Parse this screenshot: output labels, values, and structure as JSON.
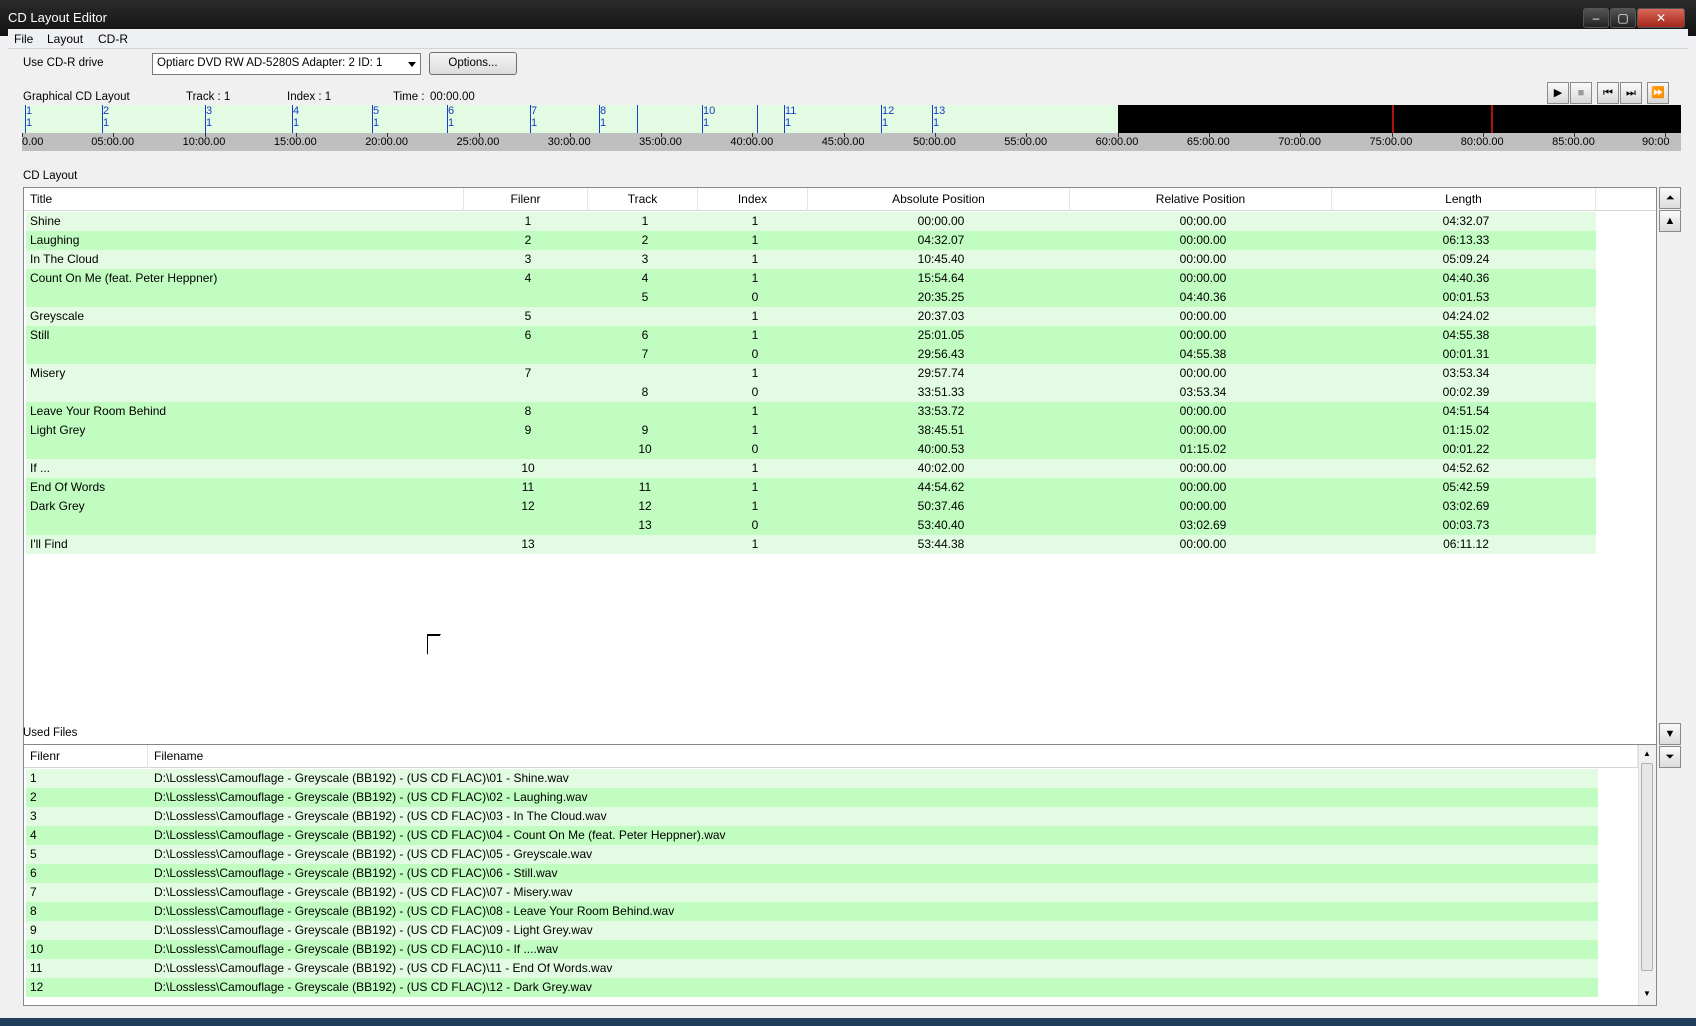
{
  "window": {
    "title": "CD Layout Editor"
  },
  "menu": [
    "File",
    "Layout",
    "CD-R"
  ],
  "drive": {
    "label": "Use CD-R drive",
    "selected": "Optiarc DVD RW AD-5280S   Adapter: 2  ID: 1",
    "options_button": "Options..."
  },
  "graphical": {
    "label": "Graphical CD Layout",
    "track": "Track : 1",
    "index": "Index : 1",
    "time_label": "Time :",
    "time_value": "00:00.00"
  },
  "transport": {
    "play": "▶",
    "stop": "■",
    "prev": "⏮",
    "next": "⏭",
    "forward": "⏩"
  },
  "timeline": {
    "tracks": [
      "1",
      "2",
      "3",
      "4",
      "5",
      "6",
      "7",
      "8",
      "10",
      "11",
      "12",
      "13"
    ],
    "times": [
      "0.00",
      "05:00.00",
      "10:00.00",
      "15:00.00",
      "20:00.00",
      "25:00.00",
      "30:00.00",
      "35:00.00",
      "40:00.00",
      "45:00.00",
      "50:00.00",
      "55:00.00",
      "60:00.00",
      "65:00.00",
      "70:00.00",
      "75:00.00",
      "80:00.00",
      "85:00.00",
      "90:00"
    ]
  },
  "cd_layout": {
    "label": "CD Layout",
    "columns": [
      "Title",
      "Filenr",
      "Track",
      "Index",
      "Absolute Position",
      "Relative Position",
      "Length"
    ],
    "rows": [
      [
        "Shine",
        "1",
        "1",
        "1",
        "00:00.00",
        "00:00.00",
        "04:32.07"
      ],
      [
        "Laughing",
        "2",
        "2",
        "1",
        "04:32.07",
        "00:00.00",
        "06:13.33"
      ],
      [
        "In The Cloud",
        "3",
        "3",
        "1",
        "10:45.40",
        "00:00.00",
        "05:09.24"
      ],
      [
        "Count On Me (feat. Peter Heppner)",
        "4",
        "4",
        "1",
        "15:54.64",
        "00:00.00",
        "04:40.36"
      ],
      [
        "",
        "",
        "5",
        "0",
        "20:35.25",
        "04:40.36",
        "00:01.53"
      ],
      [
        "Greyscale",
        "5",
        "",
        "1",
        "20:37.03",
        "00:00.00",
        "04:24.02"
      ],
      [
        "Still",
        "6",
        "6",
        "1",
        "25:01.05",
        "00:00.00",
        "04:55.38"
      ],
      [
        "",
        "",
        "7",
        "0",
        "29:56.43",
        "04:55.38",
        "00:01.31"
      ],
      [
        "Misery",
        "7",
        "",
        "1",
        "29:57.74",
        "00:00.00",
        "03:53.34"
      ],
      [
        "",
        "",
        "8",
        "0",
        "33:51.33",
        "03:53.34",
        "00:02.39"
      ],
      [
        "Leave Your Room Behind",
        "8",
        "",
        "1",
        "33:53.72",
        "00:00.00",
        "04:51.54"
      ],
      [
        "Light Grey",
        "9",
        "9",
        "1",
        "38:45.51",
        "00:00.00",
        "01:15.02"
      ],
      [
        "",
        "",
        "10",
        "0",
        "40:00.53",
        "01:15.02",
        "00:01.22"
      ],
      [
        "If ...",
        "10",
        "",
        "1",
        "40:02.00",
        "00:00.00",
        "04:52.62"
      ],
      [
        "End Of Words",
        "11",
        "11",
        "1",
        "44:54.62",
        "00:00.00",
        "05:42.59"
      ],
      [
        "Dark Grey",
        "12",
        "12",
        "1",
        "50:37.46",
        "00:00.00",
        "03:02.69"
      ],
      [
        "",
        "",
        "13",
        "0",
        "53:40.40",
        "03:02.69",
        "00:03.73"
      ],
      [
        "I'll Find",
        "13",
        "",
        "1",
        "53:44.38",
        "00:00.00",
        "06:11.12"
      ]
    ]
  },
  "used_files": {
    "label": "Used Files",
    "columns": [
      "Filenr",
      "Filename"
    ],
    "rows": [
      [
        "1",
        "D:\\Lossless\\Camouflage - Greyscale (BB192) -  (US CD FLAC)\\01 - Shine.wav"
      ],
      [
        "2",
        "D:\\Lossless\\Camouflage - Greyscale (BB192) -  (US CD FLAC)\\02 - Laughing.wav"
      ],
      [
        "3",
        "D:\\Lossless\\Camouflage - Greyscale (BB192) -  (US CD FLAC)\\03 - In The Cloud.wav"
      ],
      [
        "4",
        "D:\\Lossless\\Camouflage - Greyscale (BB192) -  (US CD FLAC)\\04 - Count On Me (feat. Peter Heppner).wav"
      ],
      [
        "5",
        "D:\\Lossless\\Camouflage - Greyscale (BB192) -  (US CD FLAC)\\05 - Greyscale.wav"
      ],
      [
        "6",
        "D:\\Lossless\\Camouflage - Greyscale (BB192) -  (US CD FLAC)\\06 - Still.wav"
      ],
      [
        "7",
        "D:\\Lossless\\Camouflage - Greyscale (BB192) -  (US CD FLAC)\\07 - Misery.wav"
      ],
      [
        "8",
        "D:\\Lossless\\Camouflage - Greyscale (BB192) -  (US CD FLAC)\\08 - Leave Your Room Behind.wav"
      ],
      [
        "9",
        "D:\\Lossless\\Camouflage - Greyscale (BB192) -  (US CD FLAC)\\09 - Light Grey.wav"
      ],
      [
        "10",
        "D:\\Lossless\\Camouflage - Greyscale (BB192) -  (US CD FLAC)\\10 - If ....wav"
      ],
      [
        "11",
        "D:\\Lossless\\Camouflage - Greyscale (BB192) -  (US CD FLAC)\\11 - End Of Words.wav"
      ],
      [
        "12",
        "D:\\Lossless\\Camouflage - Greyscale (BB192) -  (US CD FLAC)\\12 - Dark Grey.wav"
      ]
    ]
  },
  "colors": {
    "row_light": "#e2fbe2",
    "row_dark": "#c1fdc1",
    "marker": "#1a3cc8",
    "accent_red": "#b01010"
  }
}
